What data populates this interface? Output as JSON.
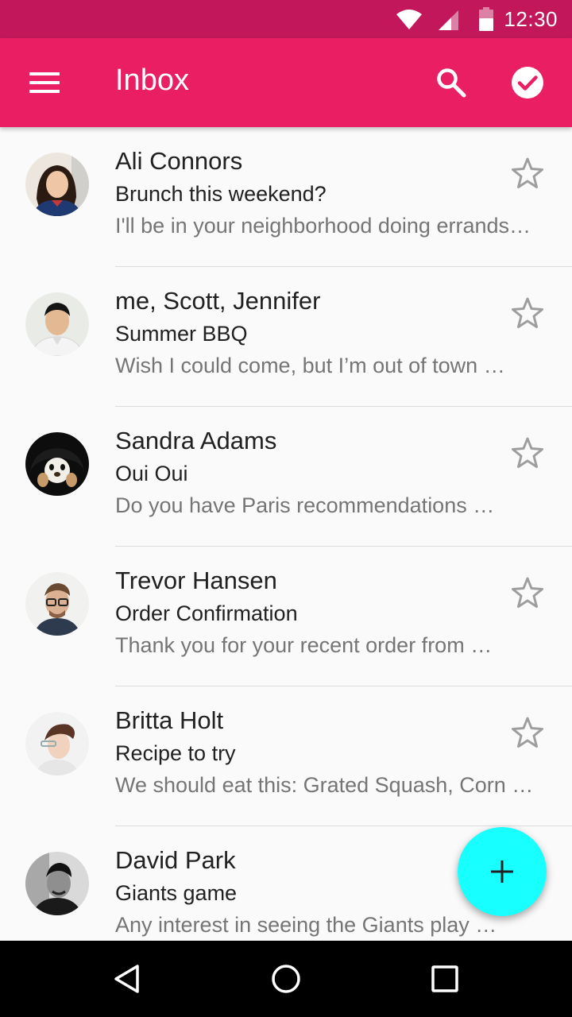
{
  "status_bar": {
    "time": "12:30",
    "icons": [
      "wifi-icon",
      "signal-icon",
      "battery-icon"
    ]
  },
  "app_bar": {
    "title": "Inbox",
    "icons": [
      "menu-icon",
      "search-icon",
      "check-circle-icon"
    ],
    "color": "#e91e63",
    "status_color": "#c2185b"
  },
  "emails": [
    {
      "sender": "Ali Connors",
      "subject": "Brunch this weekend?",
      "snippet": "I'll be in your neighborhood doing errands…",
      "starred": false
    },
    {
      "sender": "me, Scott, Jennifer",
      "subject": "Summer BBQ",
      "snippet": "Wish I could come, but I’m out of town …",
      "starred": false
    },
    {
      "sender": "Sandra Adams",
      "subject": "Oui Oui",
      "snippet": "Do you have Paris recommendations …",
      "starred": false
    },
    {
      "sender": "Trevor Hansen",
      "subject": "Order Confirmation",
      "snippet": "Thank you for your recent order from …",
      "starred": false
    },
    {
      "sender": "Britta Holt",
      "subject": "Recipe to try",
      "snippet": "We should eat this: Grated Squash, Corn …",
      "starred": false
    },
    {
      "sender": "David Park",
      "subject": "Giants game",
      "snippet": "Any interest in seeing the Giants play …",
      "starred": false
    }
  ],
  "fab": {
    "icon": "plus-icon",
    "color": "#18ffff"
  },
  "nav_bar": {
    "icons": [
      "back-icon",
      "home-icon",
      "recents-icon"
    ]
  }
}
